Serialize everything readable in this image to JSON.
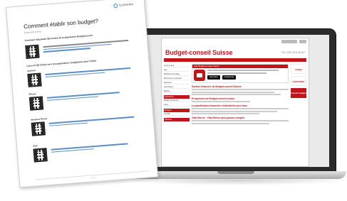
{
  "document": {
    "logo_text": "iconomix",
    "title": "Comment établir son budget?",
    "subtitle": "Codes QR et liens",
    "section_1": "Comment étiquettes QR Codes de la plateforme Budgetconseil",
    "section_2": "Liens et QR Codes vers les applications budgétaires pour l'élève",
    "blocks": [
      {
        "label": ""
      },
      {
        "label": "Android"
      },
      {
        "label": "iPhone"
      },
      {
        "label": "Windows Phone"
      },
      {
        "label": "iPad"
      }
    ],
    "page_number": "1 / 1"
  },
  "website": {
    "title": "Budget-conseil Suisse",
    "telephone": "Tél. 031 123 45 67",
    "box_title": "App Budget-conseil Suisse",
    "store_apple": "App Store",
    "store_google": "Google play",
    "sidebar_items": [
      "Liens et app",
      "App",
      "Modèles de budget",
      "Brochures et dossiers",
      "Adresses",
      "Association",
      "Médias",
      "Budget personnel",
      "Liens",
      "Contact"
    ],
    "sidebar_heads": [
      "Recherche",
      "Budgets",
      "Services"
    ],
    "headings": [
      "Soutien financier de Budget-conseil Suisse",
      "Prospectus de Budget-conseil suisse",
      "La planification financière individuelle pour tous",
      "Vital Sterne : Vital-Sterne plus jamais complet"
    ],
    "ads": [
      "coop",
      "RAIFFEISEN",
      "Conseil budget"
    ]
  }
}
